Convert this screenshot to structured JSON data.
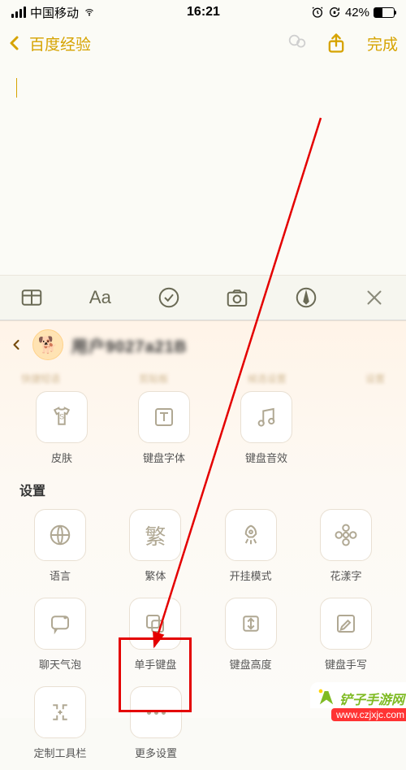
{
  "status": {
    "carrier": "中国移动",
    "time": "16:21",
    "battery_pct": "42%"
  },
  "nav": {
    "back_label": "百度经验",
    "done_label": "完成"
  },
  "toolbar": {
    "aa": "Aa"
  },
  "panel": {
    "username": "用户9027a21B",
    "clipped_row": [
      "快捷短语",
      "剪贴板",
      "候选设置",
      "设置"
    ],
    "row1": [
      {
        "label": "皮肤",
        "icon": "shirt"
      },
      {
        "label": "键盘字体",
        "icon": "text"
      },
      {
        "label": "键盘音效",
        "icon": "note"
      }
    ],
    "section_title": "设置",
    "row2": [
      {
        "label": "语言",
        "icon": "globe"
      },
      {
        "label": "繁体",
        "icon": "fan"
      },
      {
        "label": "开挂模式",
        "icon": "rocket"
      },
      {
        "label": "花漾字",
        "icon": "flower"
      }
    ],
    "row3": [
      {
        "label": "聊天气泡",
        "icon": "bubble"
      },
      {
        "label": "单手键盘",
        "icon": "overlap"
      },
      {
        "label": "键盘高度",
        "icon": "height"
      },
      {
        "label": "键盘手写",
        "icon": "handwrite"
      }
    ],
    "row4": [
      {
        "label": "定制工具栏",
        "icon": "crop"
      },
      {
        "label": "更多设置",
        "icon": "more"
      }
    ]
  },
  "watermark": {
    "logo_text": "铲子手游网",
    "url": "www.czjxjc.com"
  }
}
